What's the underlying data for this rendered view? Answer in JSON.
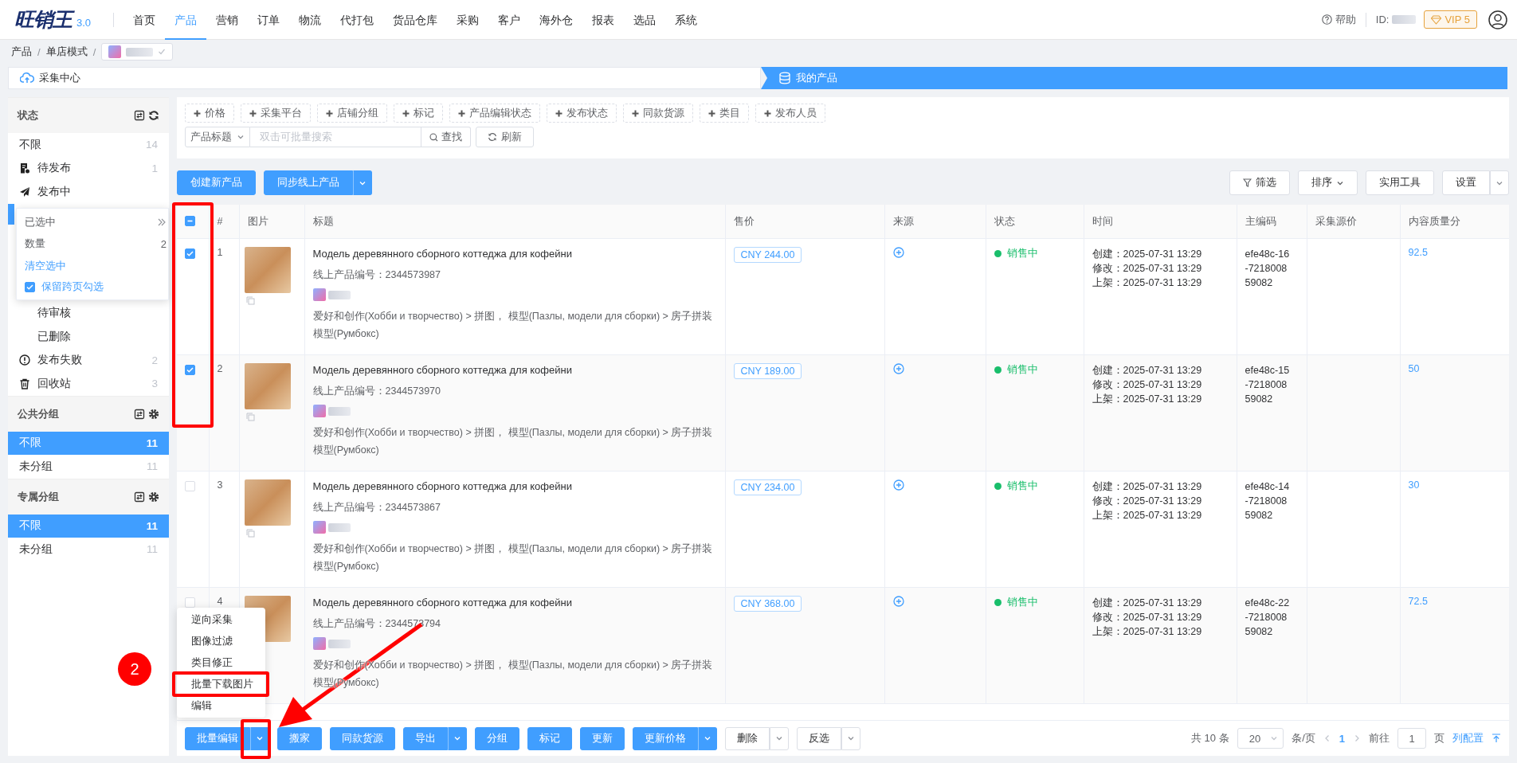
{
  "app": {
    "logo": "旺销王",
    "version": "3.0"
  },
  "nav": [
    {
      "label": "首页",
      "selected": false
    },
    {
      "label": "产品",
      "selected": true
    },
    {
      "label": "营销",
      "selected": false
    },
    {
      "label": "订单",
      "selected": false
    },
    {
      "label": "物流",
      "selected": false
    },
    {
      "label": "代打包",
      "selected": false
    },
    {
      "label": "货品仓库",
      "selected": false
    },
    {
      "label": "采购",
      "selected": false
    },
    {
      "label": "客户",
      "selected": false
    },
    {
      "label": "海外仓",
      "selected": false
    },
    {
      "label": "报表",
      "selected": false
    },
    {
      "label": "选品",
      "selected": false
    },
    {
      "label": "系统",
      "selected": false
    }
  ],
  "header_right": {
    "help": "帮助",
    "id_label": "ID:",
    "vip": "VIP 5"
  },
  "breadcrumb": {
    "separator": "/",
    "items": [
      "产品",
      "单店模式"
    ]
  },
  "steps": [
    {
      "label": "采集中心",
      "selected": false
    },
    {
      "label": "我的产品",
      "selected": true
    }
  ],
  "sidebar": {
    "sections": [
      {
        "title": "状态",
        "items": [
          {
            "kind": "plain",
            "label": "不限",
            "count": "14",
            "selected": false
          },
          {
            "kind": "pending",
            "label": "待发布",
            "count": "1",
            "selected": false
          },
          {
            "kind": "publishing",
            "label": "发布中",
            "selected": false
          },
          {
            "kind": "popover",
            "title": "已选中",
            "count_label": "数量",
            "count": "2",
            "clear_link": "清空选中",
            "keep": {
              "label": "保留跨页勾选",
              "checked": true
            }
          },
          {
            "kind": "sub",
            "label": "待审核",
            "selected": false
          },
          {
            "kind": "sub",
            "label": "已删除",
            "selected": false
          },
          {
            "kind": "failed",
            "label": "发布失败",
            "count": "2",
            "selected": false
          },
          {
            "kind": "recycle",
            "label": "回收站",
            "count": "3",
            "selected": false
          }
        ]
      },
      {
        "title": "公共分组",
        "items": [
          {
            "kind": "plain",
            "label": "不限",
            "count": "11",
            "selected": true
          },
          {
            "kind": "plain",
            "label": "未分组",
            "count": "11",
            "selected": false
          }
        ]
      },
      {
        "title": "专属分组",
        "items": [
          {
            "kind": "plain",
            "label": "不限",
            "count": "11",
            "selected": true
          },
          {
            "kind": "plain",
            "label": "未分组",
            "count": "11",
            "selected": false
          }
        ]
      }
    ]
  },
  "filters": {
    "chips": [
      "价格",
      "采集平台",
      "店铺分组",
      "标记",
      "产品编辑状态",
      "发布状态",
      "同款货源",
      "类目",
      "发布人员"
    ],
    "search": {
      "field": "产品标题",
      "placeholder": "双击可批量搜索",
      "search_button": "查找",
      "refresh_button": "刷新"
    }
  },
  "toolbar": {
    "left": [
      {
        "label": "创建新产品",
        "kind": "primary"
      },
      {
        "label": "同步线上产品",
        "kind": "dropdown"
      }
    ],
    "right": [
      {
        "label": "筛选",
        "kind": "filter"
      },
      {
        "label": "排序",
        "kind": "sort"
      },
      {
        "label": "实用工具",
        "kind": "plain"
      },
      {
        "label": "设置",
        "kind": "menu"
      }
    ]
  },
  "table": {
    "select_all": {
      "indeterminate": true
    },
    "columns": [
      "#",
      "图片",
      "标题",
      "售价",
      "来源",
      "状态",
      "时间",
      "主编码",
      "采集源价",
      "内容质量分"
    ],
    "rows": [
      {
        "selected": true,
        "index": "1",
        "title": "Модель деревянного сборного коттеджа для кофейни",
        "product_no": "线上产品编号：2344573987",
        "category": "爱好和创作(Хобби и творчество) > 拼图， 模型(Пазлы, модели для сборки) > 房子拼装模型(Румбокс)",
        "price": "CNY 244.00",
        "status": "销售中",
        "times": [
          "创建：2025-07-31 13:29",
          "修改：2025-07-31 13:29",
          "上架：2025-07-31 13:29"
        ],
        "code": "efe48c-16-721800859082",
        "score": "92.5"
      },
      {
        "selected": true,
        "index": "2",
        "title": "Модель деревянного сборного коттеджа для кофейни",
        "product_no": "线上产品编号：2344573970",
        "category": "爱好和创作(Хобби и творчество) > 拼图， 模型(Пазлы, модели для сборки) > 房子拼装模型(Румбокс)",
        "price": "CNY 189.00",
        "status": "销售中",
        "times": [
          "创建：2025-07-31 13:29",
          "修改：2025-07-31 13:29",
          "上架：2025-07-31 13:29"
        ],
        "code": "efe48c-15-721800859082",
        "score": "50"
      },
      {
        "selected": false,
        "index": "3",
        "title": "Модель деревянного сборного коттеджа для кофейни",
        "product_no": "线上产品编号：2344573867",
        "category": "爱好和创作(Хобби и творчество) > 拼图， 模型(Пазлы, модели для сборки) > 房子拼装模型(Румбокс)",
        "price": "CNY 234.00",
        "status": "销售中",
        "times": [
          "创建：2025-07-31 13:29",
          "修改：2025-07-31 13:29",
          "上架：2025-07-31 13:29"
        ],
        "code": "efe48c-14-721800859082",
        "score": "30"
      },
      {
        "selected": false,
        "index": "4",
        "title": "Модель деревянного сборного коттеджа для кофейни",
        "product_no": "线上产品编号：2344573794",
        "category": "爱好和创作(Хобби и творчество) > 拼图， 模型(Пазлы, модели для сборки) > 房子拼装模型(Румбокс)",
        "price": "CNY 368.00",
        "status": "销售中",
        "times": [
          "创建：2025-07-31 13:29",
          "修改：2025-07-31 13:29",
          "上架：2025-07-31 13:29"
        ],
        "code": "efe48c-22-721800859082",
        "score": "72.5"
      }
    ]
  },
  "bottom_bar": {
    "buttons": [
      {
        "label": "批量编辑",
        "kind": "dropdown"
      },
      {
        "label": "搬家",
        "kind": "primary"
      },
      {
        "label": "同款货源",
        "kind": "primary"
      },
      {
        "label": "导出",
        "kind": "dropdown"
      },
      {
        "label": "分组",
        "kind": "primary"
      },
      {
        "label": "标记",
        "kind": "primary"
      },
      {
        "label": "更新",
        "kind": "primary"
      },
      {
        "label": "更新价格",
        "kind": "dropdown"
      },
      {
        "label": "删除",
        "kind": "menu"
      },
      {
        "label": "反选",
        "kind": "menu"
      }
    ],
    "total": "共 10 条",
    "page_size": "20",
    "per_page": "条/页",
    "pages": [
      {
        "label": "1",
        "selected": true
      }
    ],
    "goto_label": "前往",
    "goto_value": "1",
    "page_unit": "页",
    "columns_link": "列配置"
  },
  "dropdown": {
    "items": [
      {
        "label": "逆向采集",
        "highlighted": false
      },
      {
        "label": "图像过滤",
        "highlighted": false
      },
      {
        "label": "类目修正",
        "highlighted": false
      },
      {
        "label": "批量下载图片",
        "highlighted": true
      },
      {
        "label": "编辑",
        "highlighted": false
      }
    ]
  },
  "annotations": {
    "step_badge": "2"
  }
}
